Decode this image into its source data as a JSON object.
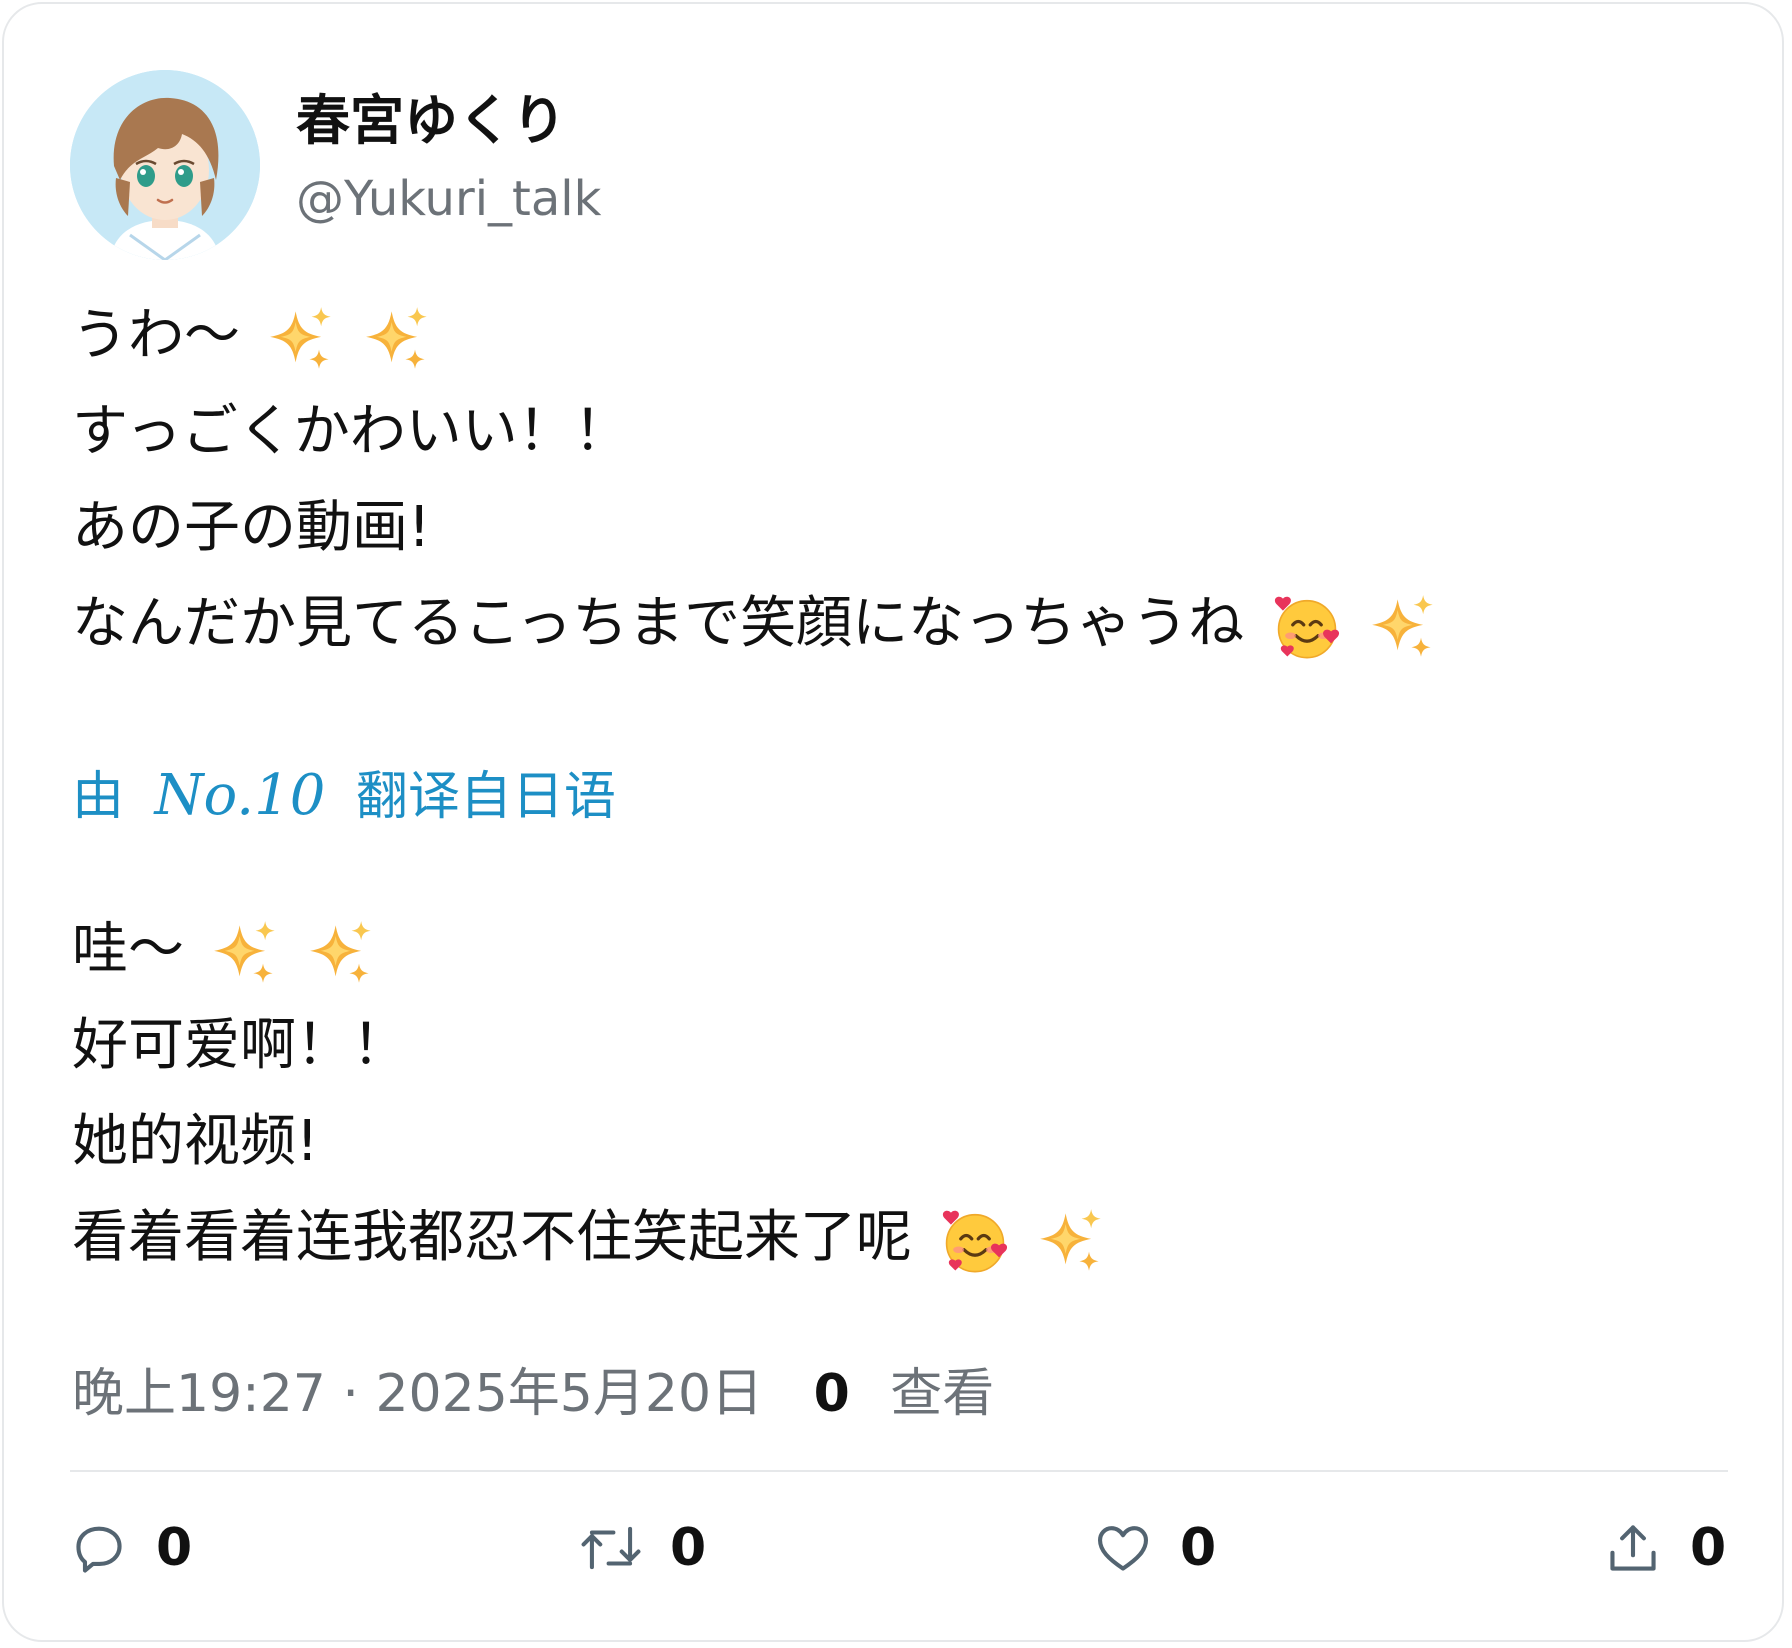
{
  "author": {
    "display_name": "春宮ゆくり",
    "handle": "@Yukuri_talk"
  },
  "original": {
    "lines": [
      "うわ〜",
      "すっごくかわいい！！",
      "あの子の動画!",
      "なんだか見てるこっちまで笑顔になっちゃうね"
    ]
  },
  "translation": {
    "prefix": "由",
    "engine": "No.10",
    "suffix": "翻译自日语",
    "lines": [
      "哇〜",
      "好可爱啊！！",
      "她的视频!",
      "看着看着连我都忍不住笑起来了呢"
    ]
  },
  "meta": {
    "timestamp": "晚上19:27 · 2025年5月20日",
    "views_count": "0",
    "views_label": "查看"
  },
  "actions": {
    "reply": {
      "icon": "reply-icon",
      "count": "0"
    },
    "retweet": {
      "icon": "retweet-icon",
      "count": "0"
    },
    "like": {
      "icon": "heart-icon",
      "count": "0"
    },
    "share": {
      "icon": "share-icon",
      "count": "0"
    }
  },
  "colors": {
    "link": "#1d8fc5",
    "secondary_text": "#6c7278",
    "primary_text": "#111111",
    "avatar_bg": "#c7e8f6"
  }
}
